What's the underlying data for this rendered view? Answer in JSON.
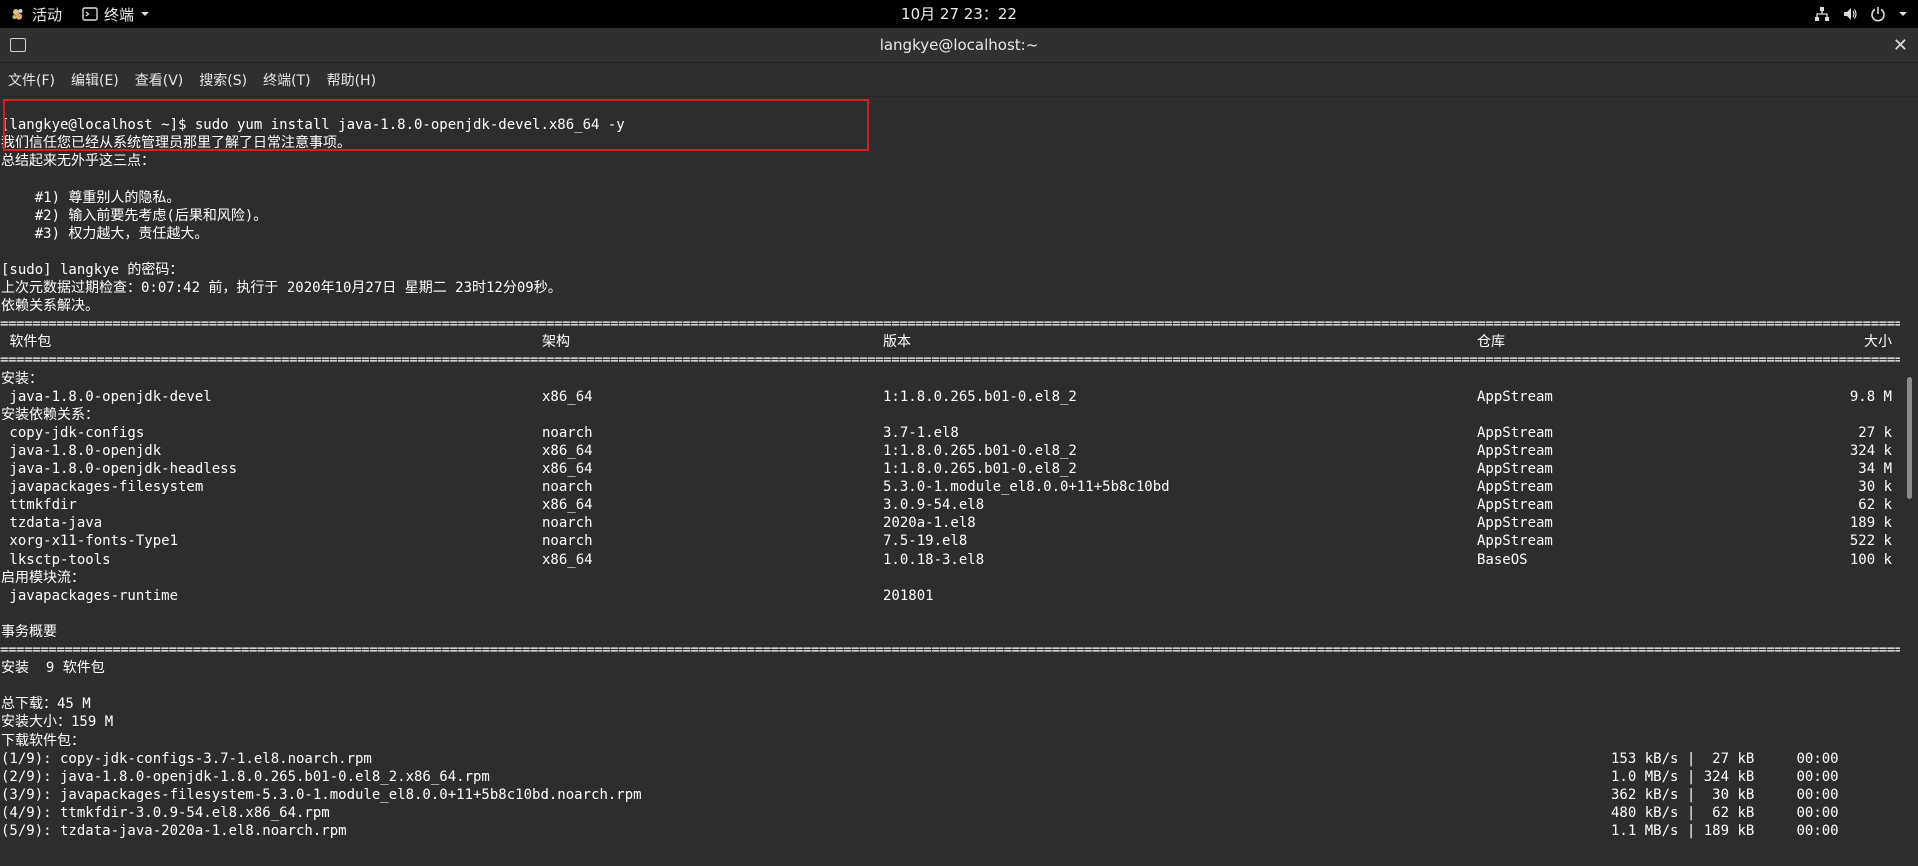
{
  "topbar": {
    "activities": "活动",
    "app_menu": "终端",
    "clock": "10月 27  23：22"
  },
  "window": {
    "title": "langkye@localhost:~"
  },
  "menubar": {
    "items": [
      "文件(F)",
      "编辑(E)",
      "查看(V)",
      "搜索(S)",
      "终端(T)",
      "帮助(H)"
    ]
  },
  "terminal": {
    "prompt": "[langkye@localhost ~]$ sudo yum install java-1.8.0-openjdk-devel.x86_64 -y",
    "lecture": [
      "我们信任您已经从系统管理员那里了解了日常注意事项。",
      "总结起来无外乎这三点：",
      "",
      "    #1) 尊重别人的隐私。",
      "    #2) 输入前要先考虑(后果和风险)。",
      "    #3) 权力越大，责任越大。",
      "",
      "[sudo] langkye 的密码：",
      "上次元数据过期检查：0:07:42 前，执行于 2020年10月27日 星期二 23时12分09秒。",
      "依赖关系解决。"
    ],
    "table_header": {
      "package": " 软件包",
      "arch": "架构",
      "version": "版本",
      "repo": "仓库",
      "size": "大小"
    },
    "install_label": "安装：",
    "install_rows": [
      {
        "package": " java-1.8.0-openjdk-devel",
        "arch": "x86_64",
        "version": "1:1.8.0.265.b01-0.el8_2",
        "repo": "AppStream",
        "size": "9.8 M"
      }
    ],
    "deps_label": "安装依赖关系：",
    "dep_rows": [
      {
        "package": " copy-jdk-configs",
        "arch": "noarch",
        "version": "3.7-1.el8",
        "repo": "AppStream",
        "size": "27 k"
      },
      {
        "package": " java-1.8.0-openjdk",
        "arch": "x86_64",
        "version": "1:1.8.0.265.b01-0.el8_2",
        "repo": "AppStream",
        "size": "324 k"
      },
      {
        "package": " java-1.8.0-openjdk-headless",
        "arch": "x86_64",
        "version": "1:1.8.0.265.b01-0.el8_2",
        "repo": "AppStream",
        "size": "34 M"
      },
      {
        "package": " javapackages-filesystem",
        "arch": "noarch",
        "version": "5.3.0-1.module_el8.0.0+11+5b8c10bd",
        "repo": "AppStream",
        "size": "30 k"
      },
      {
        "package": " ttmkfdir",
        "arch": "x86_64",
        "version": "3.0.9-54.el8",
        "repo": "AppStream",
        "size": "62 k"
      },
      {
        "package": " tzdata-java",
        "arch": "noarch",
        "version": "2020a-1.el8",
        "repo": "AppStream",
        "size": "189 k"
      },
      {
        "package": " xorg-x11-fonts-Type1",
        "arch": "noarch",
        "version": "7.5-19.el8",
        "repo": "AppStream",
        "size": "522 k"
      },
      {
        "package": " lksctp-tools",
        "arch": "x86_64",
        "version": "1.0.18-3.el8",
        "repo": "BaseOS",
        "size": "100 k"
      }
    ],
    "module_label": "启用模块流：",
    "module_rows": [
      {
        "package": " javapackages-runtime",
        "arch": "",
        "version": "201801",
        "repo": "",
        "size": ""
      }
    ],
    "summary_title": "事务概要",
    "summary_install": "安装  9 软件包",
    "total_download": "总下载：45 M",
    "install_size": "安装大小：159 M",
    "downloading": "下载软件包：",
    "downloads": [
      {
        "file": "(1/9): copy-jdk-configs-3.7-1.el8.noarch.rpm",
        "speed": "153 kB/s",
        "size": " 27 kB",
        "time": "00:00"
      },
      {
        "file": "(2/9): java-1.8.0-openjdk-1.8.0.265.b01-0.el8_2.x86_64.rpm",
        "speed": "1.0 MB/s",
        "size": "324 kB",
        "time": "00:00"
      },
      {
        "file": "(3/9): javapackages-filesystem-5.3.0-1.module_el8.0.0+11+5b8c10bd.noarch.rpm",
        "speed": "362 kB/s",
        "size": " 30 kB",
        "time": "00:00"
      },
      {
        "file": "(4/9): ttmkfdir-3.0.9-54.el8.x86_64.rpm",
        "speed": "480 kB/s",
        "size": " 62 kB",
        "time": "00:00"
      },
      {
        "file": "(5/9): tzdata-java-2020a-1.el8.noarch.rpm",
        "speed": "1.1 MB/s",
        "size": "189 kB",
        "time": "00:00"
      }
    ]
  }
}
